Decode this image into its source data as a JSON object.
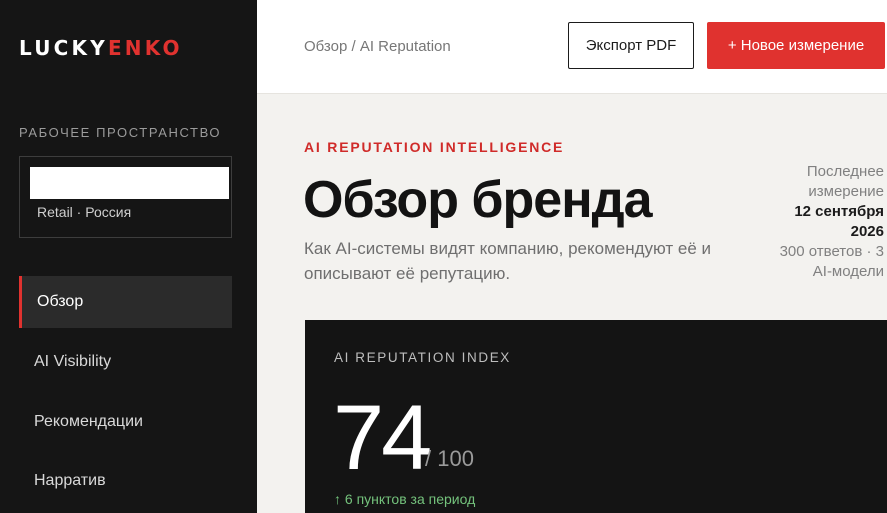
{
  "sidebar": {
    "logo": {
      "part1": "LUCKY",
      "part2": "ENKO"
    },
    "workspace_heading": "РАБОЧЕЕ ПРОСТРАНСТВО",
    "workspace": {
      "name": "",
      "meta": "Retail · Россия"
    },
    "nav": [
      {
        "label": "Обзор",
        "active": true
      },
      {
        "label": "AI Visibility",
        "active": false
      },
      {
        "label": "Рекомендации",
        "active": false
      },
      {
        "label": "Нарратив",
        "active": false
      }
    ]
  },
  "header": {
    "breadcrumb": "Обзор / AI Reputation",
    "export_label": "Экспорт PDF",
    "new_label": "+ Новое измерение"
  },
  "main": {
    "eyebrow": "AI REPUTATION INTELLIGENCE",
    "title": "Обзор бренда",
    "subtitle": "Как AI-системы видят компанию, рекомендуют её и описывают её репутацию.",
    "last_measure": {
      "label": "Последнее измерение",
      "date": "12 сентября 2026",
      "details": "300 ответов · 3 AI-модели"
    },
    "index_card": {
      "label": "AI REPUTATION INDEX",
      "score": "74",
      "max": "/ 100",
      "delta": "↑ 6 пунктов за период"
    }
  },
  "colors": {
    "accent": "#e0322f",
    "sidebar_bg": "#151515",
    "page_bg": "#f3f2ef",
    "positive": "#74c27c"
  }
}
